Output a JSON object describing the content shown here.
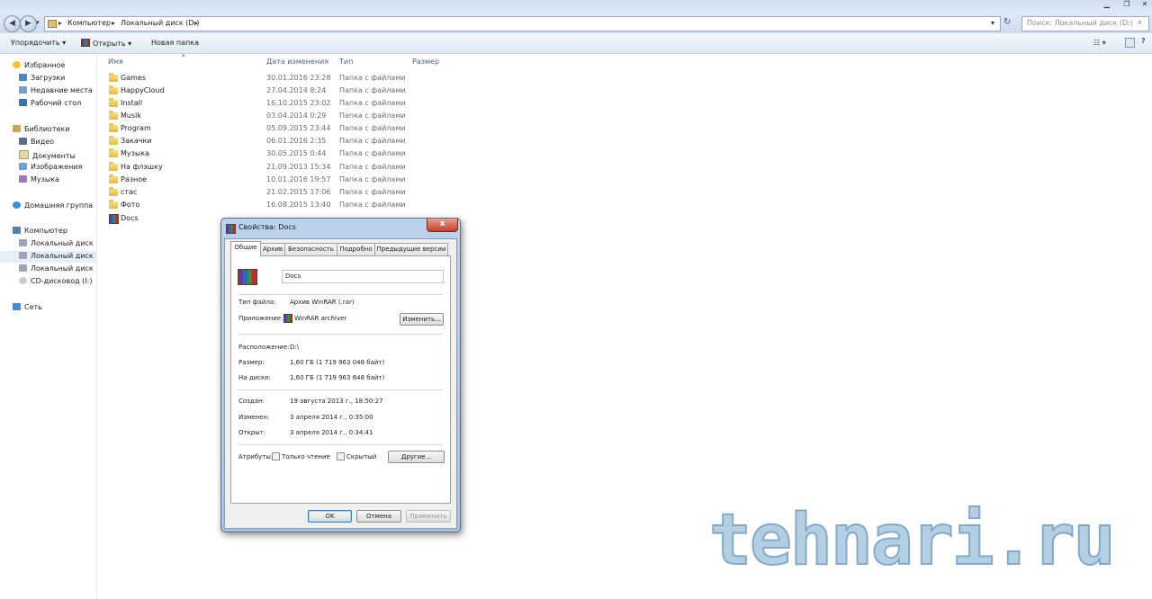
{
  "address": {
    "crumbs": [
      "Компьютер",
      "Локальный диск (D:)"
    ],
    "search_placeholder": "Поиск: Локальный диск (D:)"
  },
  "toolbar": {
    "organize": "Упорядочить",
    "open": "Открыть",
    "new_folder": "Новая папка"
  },
  "nav": {
    "favorites": "Избранное",
    "downloads": "Загрузки",
    "recent": "Недавние места",
    "desktop": "Рабочий стол",
    "libraries": "Библиотеки",
    "video": "Видео",
    "documents": "Документы",
    "pictures": "Изображения",
    "music": "Музыка",
    "homegroup": "Домашняя группа",
    "computer": "Компьютер",
    "drive_c": "Локальный диск (C",
    "drive_d": "Локальный диск (D",
    "drive_e": "Локальный диск (E:",
    "cd": "CD-дисковод (I:)",
    "network": "Сеть"
  },
  "columns": {
    "name": "Имя",
    "date": "Дата изменения",
    "type": "Тип",
    "size": "Размер"
  },
  "files": [
    {
      "name": "Games",
      "date": "30.01.2016 23:28",
      "type": "Папка с файлами"
    },
    {
      "name": "HappyCloud",
      "date": "27.04.2014 8:24",
      "type": "Папка с файлами"
    },
    {
      "name": "Install",
      "date": "16.10.2015 23:02",
      "type": "Папка с файлами"
    },
    {
      "name": "Musik",
      "date": "03.04.2014 0:29",
      "type": "Папка с файлами"
    },
    {
      "name": "Program",
      "date": "05.09.2015 23:44",
      "type": "Папка с файлами"
    },
    {
      "name": "Закачки",
      "date": "06.01.2016 2:35",
      "type": "Папка с файлами"
    },
    {
      "name": "Музыка",
      "date": "30.05.2015 0:44",
      "type": "Папка с файлами"
    },
    {
      "name": "На флэшку",
      "date": "21.09.2013 15:34",
      "type": "Папка с файлами"
    },
    {
      "name": "Разное",
      "date": "10.01.2016 19:57",
      "type": "Папка с файлами"
    },
    {
      "name": "стас",
      "date": "21.02.2015 17:06",
      "type": "Папка с файлами"
    },
    {
      "name": "Фото",
      "date": "16.08.2015 13:40",
      "type": "Папка с файлами"
    },
    {
      "name": "Docs",
      "date": "",
      "type": ""
    }
  ],
  "dialog": {
    "title": "Свойства: Docs",
    "close": "x",
    "tabs": [
      "Общие",
      "Архив",
      "Безопасность",
      "Подробно",
      "Предыдущие версии"
    ],
    "filename": "Docs",
    "filetype_label": "Тип файла:",
    "filetype_value": "Архив WinRAR (.rar)",
    "app_label": "Приложение:",
    "app_value": "WinRAR archiver",
    "change_button": "Изменить...",
    "location_label": "Расположение:",
    "location_value": "D:\\",
    "size_label": "Размер:",
    "size_value": "1,60 ГБ (1 719 963 048 байт)",
    "disk_label": "На диске:",
    "disk_value": "1,60 ГБ (1 719 963 648 байт)",
    "created_label": "Создан:",
    "created_value": "19 августа 2013 г., 18:50:27",
    "modified_label": "Изменен:",
    "modified_value": "3 апреля 2014 г., 0:35:00",
    "opened_label": "Открыт:",
    "opened_value": "3 апреля 2014 г., 0:34:41",
    "attributes_label": "Атрибуты:",
    "readonly_label": "Только чтение",
    "hidden_label": "Скрытый",
    "other_button": "Другие...",
    "ok": "OK",
    "cancel": "Отмена",
    "apply": "Применить"
  },
  "watermark": "tehnari.ru"
}
